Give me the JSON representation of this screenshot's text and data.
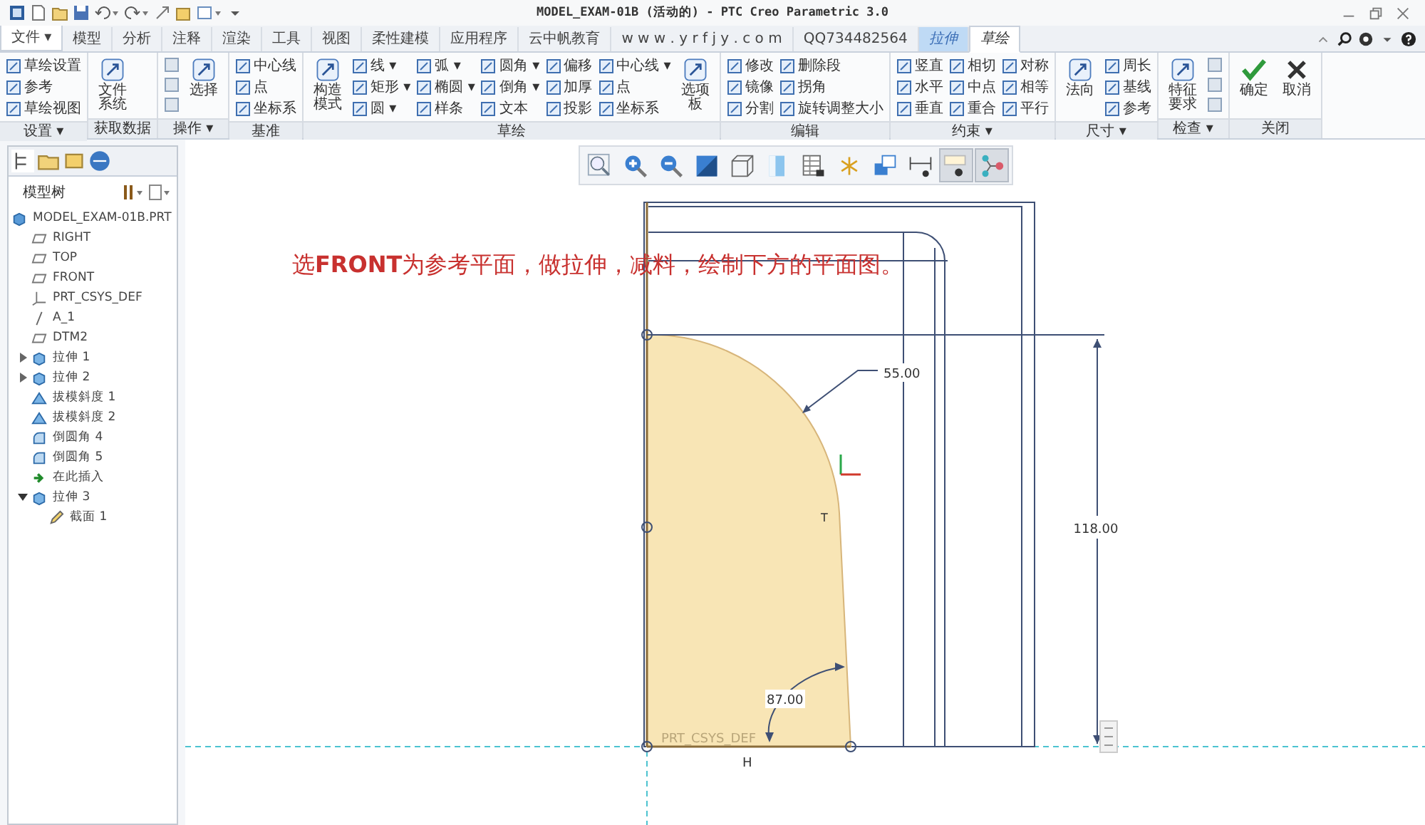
{
  "window": {
    "title": "MODEL_EXAM-01B (活动的) - PTC Creo Parametric 3.0"
  },
  "ribbon_tabs": [
    {
      "label": "文件 ▾",
      "kind": "file",
      "selected": false
    },
    {
      "label": "模型",
      "kind": "normal",
      "selected": false
    },
    {
      "label": "分析",
      "kind": "normal",
      "selected": false
    },
    {
      "label": "注释",
      "kind": "normal",
      "selected": false
    },
    {
      "label": "渲染",
      "kind": "normal",
      "selected": false
    },
    {
      "label": "工具",
      "kind": "normal",
      "selected": false
    },
    {
      "label": "视图",
      "kind": "normal",
      "selected": false
    },
    {
      "label": "柔性建模",
      "kind": "normal",
      "selected": false
    },
    {
      "label": "应用程序",
      "kind": "normal",
      "selected": false
    },
    {
      "label": "云中帆教育",
      "kind": "normal",
      "selected": false
    },
    {
      "label": "w w w . y r f j y . c o m",
      "kind": "normal",
      "selected": false
    },
    {
      "label": "QQ734482564",
      "kind": "normal",
      "selected": false
    },
    {
      "label": "拉伸",
      "kind": "contextual",
      "selected": false
    },
    {
      "label": "草绘",
      "kind": "contextual",
      "selected": true
    }
  ],
  "ribbon_groups": [
    {
      "label": "设置 ▾",
      "columns": [
        [
          {
            "label": "草绘设置",
            "kind": "small"
          },
          {
            "label": "参考",
            "kind": "small"
          },
          {
            "label": "草绘视图",
            "kind": "small"
          }
        ]
      ]
    },
    {
      "label": "获取数据",
      "columns": [
        [
          {
            "label": "文件系统",
            "kind": "large"
          }
        ]
      ]
    },
    {
      "label": "操作 ▾",
      "columns": [
        [
          {
            "kind": "icon"
          },
          {
            "kind": "icon"
          },
          {
            "kind": "icon"
          }
        ],
        [
          {
            "label": "选择",
            "kind": "large"
          }
        ]
      ]
    },
    {
      "label": "基准",
      "columns": [
        [
          {
            "label": "中心线",
            "kind": "small"
          },
          {
            "label": "点",
            "kind": "small"
          },
          {
            "label": "坐标系",
            "kind": "small"
          }
        ]
      ]
    },
    {
      "label": "草绘",
      "columns": [
        [
          {
            "label": "构造模式",
            "kind": "large"
          }
        ],
        [
          {
            "label": "线 ▾",
            "kind": "small"
          },
          {
            "label": "矩形 ▾",
            "kind": "small"
          },
          {
            "label": "圆 ▾",
            "kind": "small"
          }
        ],
        [
          {
            "label": "弧 ▾",
            "kind": "small"
          },
          {
            "label": "椭圆 ▾",
            "kind": "small"
          },
          {
            "label": "样条",
            "kind": "small"
          }
        ],
        [
          {
            "label": "圆角 ▾",
            "kind": "small"
          },
          {
            "label": "倒角 ▾",
            "kind": "small"
          },
          {
            "label": "文本",
            "kind": "small"
          }
        ],
        [
          {
            "label": "偏移",
            "kind": "small"
          },
          {
            "label": "加厚",
            "kind": "small"
          },
          {
            "label": "投影",
            "kind": "small"
          }
        ],
        [
          {
            "label": "中心线 ▾",
            "kind": "small"
          },
          {
            "label": "点",
            "kind": "small"
          },
          {
            "label": "坐标系",
            "kind": "small"
          }
        ],
        [
          {
            "label": "选项板",
            "kind": "large"
          }
        ]
      ]
    },
    {
      "label": "编辑",
      "columns": [
        [
          {
            "label": "修改",
            "kind": "small"
          },
          {
            "label": "镜像",
            "kind": "small"
          },
          {
            "label": "分割",
            "kind": "small"
          }
        ],
        [
          {
            "label": "删除段",
            "kind": "small"
          },
          {
            "label": "拐角",
            "kind": "small"
          },
          {
            "label": "旋转调整大小",
            "kind": "small"
          }
        ]
      ]
    },
    {
      "label": "约束 ▾",
      "columns": [
        [
          {
            "label": "竖直",
            "kind": "small"
          },
          {
            "label": "水平",
            "kind": "small"
          },
          {
            "label": "垂直",
            "kind": "small"
          }
        ],
        [
          {
            "label": "相切",
            "kind": "small"
          },
          {
            "label": "中点",
            "kind": "small"
          },
          {
            "label": "重合",
            "kind": "small"
          }
        ],
        [
          {
            "label": "对称",
            "kind": "small"
          },
          {
            "label": "相等",
            "kind": "small"
          },
          {
            "label": "平行",
            "kind": "small"
          }
        ]
      ]
    },
    {
      "label": "尺寸 ▾",
      "columns": [
        [
          {
            "label": "法向",
            "kind": "large"
          }
        ],
        [
          {
            "label": "周长",
            "kind": "small"
          },
          {
            "label": "基线",
            "kind": "small"
          },
          {
            "label": "参考",
            "kind": "small"
          }
        ]
      ]
    },
    {
      "label": "检查 ▾",
      "columns": [
        [
          {
            "label": "特征要求",
            "kind": "large"
          }
        ],
        [
          {
            "kind": "icon"
          },
          {
            "kind": "icon"
          },
          {
            "kind": "icon"
          }
        ]
      ]
    },
    {
      "label": "关闭",
      "columns": [
        [
          {
            "label": "确定",
            "kind": "confirm"
          }
        ],
        [
          {
            "label": "取消",
            "kind": "cancel"
          }
        ]
      ]
    }
  ],
  "model_tree": {
    "title": "模型树",
    "root": {
      "label": "MODEL_EXAM-01B.PRT",
      "kind": "part",
      "children": [
        {
          "label": "RIGHT",
          "kind": "plane",
          "has_children": false,
          "expanded": false
        },
        {
          "label": "TOP",
          "kind": "plane",
          "has_children": false,
          "expanded": false
        },
        {
          "label": "FRONT",
          "kind": "plane",
          "has_children": false,
          "expanded": false
        },
        {
          "label": "PRT_CSYS_DEF",
          "kind": "csys",
          "has_children": false,
          "expanded": false
        },
        {
          "label": "A_1",
          "kind": "axis",
          "has_children": false,
          "expanded": false
        },
        {
          "label": "DTM2",
          "kind": "plane",
          "has_children": false,
          "expanded": false
        },
        {
          "label": "拉伸 1",
          "kind": "feature",
          "has_children": true,
          "expanded": false
        },
        {
          "label": "拉伸 2",
          "kind": "feature",
          "has_children": true,
          "expanded": false
        },
        {
          "label": "拔模斜度 1",
          "kind": "draft",
          "has_children": false,
          "expanded": false
        },
        {
          "label": "拔模斜度 2",
          "kind": "draft",
          "has_children": false,
          "expanded": false
        },
        {
          "label": "倒圆角 4",
          "kind": "round",
          "has_children": false,
          "expanded": false
        },
        {
          "label": "倒圆角 5",
          "kind": "round",
          "has_children": false,
          "expanded": false
        },
        {
          "label": "在此插入",
          "kind": "insert",
          "has_children": false,
          "expanded": false
        },
        {
          "label": "拉伸 3",
          "kind": "feature",
          "has_children": true,
          "expanded": true,
          "children": [
            {
              "label": "截面 1",
              "kind": "section"
            }
          ]
        }
      ]
    }
  },
  "view_toolbar": {
    "buttons": [
      {
        "selected": false
      },
      {
        "selected": false
      },
      {
        "selected": false
      },
      {
        "selected": false
      },
      {
        "selected": false
      },
      {
        "selected": false
      },
      {
        "selected": false
      },
      {
        "selected": false
      },
      {
        "selected": false
      },
      {
        "selected": false
      },
      {
        "selected": true
      },
      {
        "selected": true
      }
    ]
  },
  "canvas": {
    "instruction": "选**FRONT**为参考平面，做拉伸，减料，绘制下方的平面图。",
    "radius_dim": "55.00",
    "height_dim": "118.00",
    "angle_dim": "87.00",
    "csys_label": "PRT_CSYS_DEF",
    "h_label": "H",
    "t_label": "T"
  }
}
